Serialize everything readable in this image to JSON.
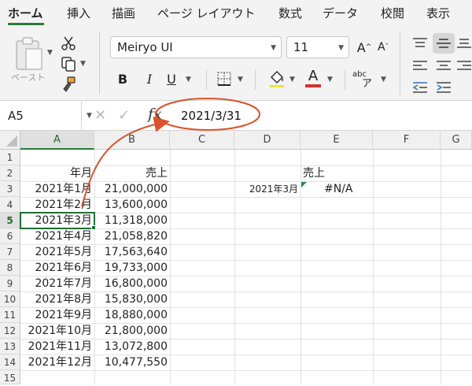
{
  "tabs": [
    {
      "label": "ホーム",
      "active": true
    },
    {
      "label": "挿入"
    },
    {
      "label": "描画"
    },
    {
      "label": "ページ レイアウト"
    },
    {
      "label": "数式"
    },
    {
      "label": "データ"
    },
    {
      "label": "校閲"
    },
    {
      "label": "表示"
    }
  ],
  "ribbon": {
    "paste_label": "ペースト",
    "font_name": "Meiryo UI",
    "font_size": "11",
    "bold_label": "B",
    "italic_label": "I",
    "underline_label": "U",
    "font_color_label": "A",
    "grow_font_label": "A",
    "shrink_font_label": "A",
    "phonetic_label": "abc",
    "phonetic_sub": "ア",
    "colors": {
      "accent": "#2a7a3b",
      "font_color_bar": "#d9312b",
      "highlight_bar": "#f5e03a",
      "annotation": "#d9532b"
    }
  },
  "formula_bar": {
    "name_box": "A5",
    "fx_label": "fx",
    "formula": "2021/3/31"
  },
  "grid": {
    "columns": [
      "A",
      "B",
      "C",
      "D",
      "E",
      "F",
      "G"
    ],
    "rows": [
      "1",
      "2",
      "3",
      "4",
      "5",
      "6",
      "7",
      "8",
      "9",
      "10",
      "11",
      "12",
      "13",
      "14",
      "15"
    ],
    "active_cell": "A5",
    "headers": {
      "a2": "年月",
      "b2": "売上",
      "e2": "売上"
    },
    "table": [
      {
        "month": "2021年1月",
        "sales": "21,000,000"
      },
      {
        "month": "2021年2月",
        "sales": "13,600,000"
      },
      {
        "month": "2021年3月",
        "sales": "11,318,000"
      },
      {
        "month": "2021年4月",
        "sales": "21,058,820"
      },
      {
        "month": "2021年5月",
        "sales": "17,563,640"
      },
      {
        "month": "2021年6月",
        "sales": "19,733,000"
      },
      {
        "month": "2021年7月",
        "sales": "16,800,000"
      },
      {
        "month": "2021年8月",
        "sales": "15,830,000"
      },
      {
        "month": "2021年9月",
        "sales": "18,880,000"
      },
      {
        "month": "2021年10月",
        "sales": "21,800,000"
      },
      {
        "month": "2021年11月",
        "sales": "13,072,800"
      },
      {
        "month": "2021年12月",
        "sales": "10,477,550"
      }
    ],
    "lookup": {
      "key": "2021年3月",
      "result": "#N/A"
    }
  }
}
